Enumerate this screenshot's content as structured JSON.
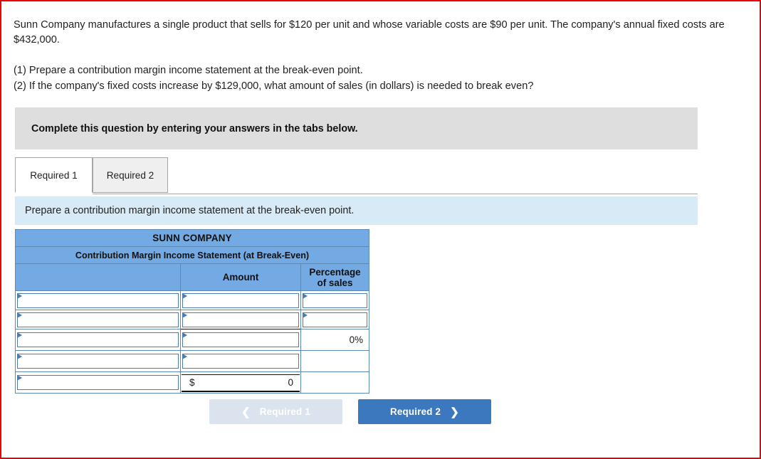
{
  "problem": {
    "statement": "Sunn Company manufactures a single product that sells for $120 per unit and whose variable costs are $90 per unit. The company's annual fixed costs are $432,000.",
    "question_1": "(1) Prepare a contribution margin income statement at the break-even point.",
    "question_2": "(2) If the company's fixed costs increase by $129,000, what amount of sales (in dollars) is needed to break even?"
  },
  "banner": {
    "instruction": "Complete this question by entering your answers in the tabs below."
  },
  "tabs": [
    {
      "label": "Required 1",
      "active": true
    },
    {
      "label": "Required 2",
      "active": false
    }
  ],
  "sub_instruction": "Prepare a contribution margin income statement at the break-even point.",
  "worksheet": {
    "title_line_1": "SUNN COMPANY",
    "title_line_2": "Contribution Margin Income Statement (at Break-Even)",
    "columns": {
      "description": "",
      "amount": "Amount",
      "percentage_line_1": "Percentage",
      "percentage_line_2": "of sales"
    },
    "rows": [
      {
        "description": "",
        "amount": "",
        "percentage": ""
      },
      {
        "description": "",
        "amount": "",
        "percentage": ""
      },
      {
        "description": "",
        "amount": "",
        "percentage": "0%"
      },
      {
        "description": "",
        "amount": "",
        "percentage": ""
      },
      {
        "description": "",
        "amount_currency": "$",
        "amount": "0",
        "percentage": ""
      }
    ]
  },
  "nav": {
    "prev_label": "Required 1",
    "prev_icon": "chevron-left-icon",
    "next_label": "Required 2",
    "next_icon": "chevron-right-icon"
  },
  "colors": {
    "header_blue": "#73aae4",
    "banner_blue": "#d9eaf7",
    "banner_gray": "#dedede",
    "button_active": "#3b78bd",
    "button_disabled": "#dbe3ef",
    "page_border_red": "#e8050a"
  }
}
